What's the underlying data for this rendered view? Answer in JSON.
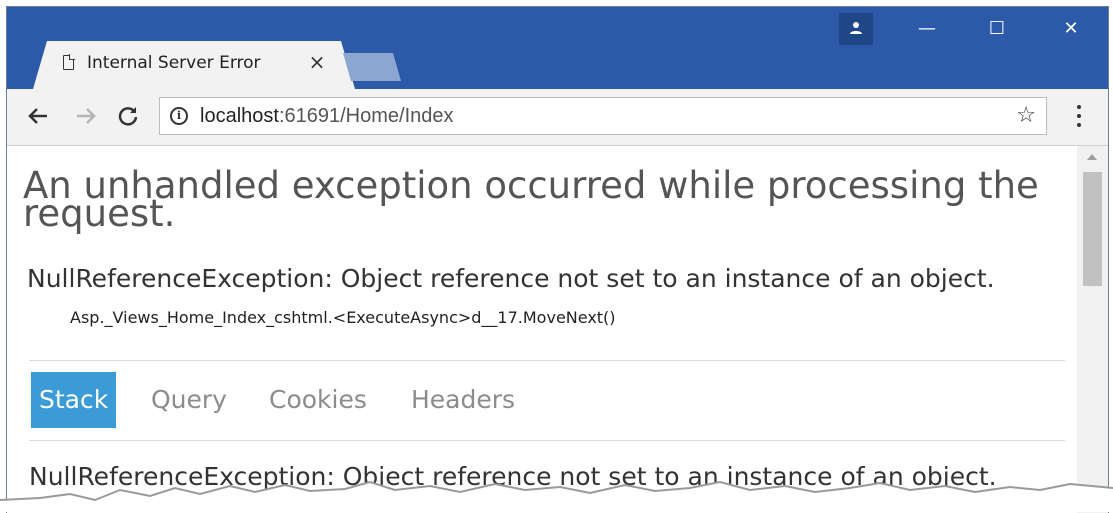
{
  "browser": {
    "tab_title": "Internal Server Error",
    "tab_close": "×",
    "url_host": "localhost",
    "url_rest": ":61691/Home/Index",
    "info_glyph": "i",
    "star_glyph": "☆",
    "window_controls": {
      "minimize": "—",
      "maximize": "☐",
      "close": "✕"
    },
    "colors": {
      "titlebar": "#2c5aa8",
      "tab_bg": "#f2f2f2",
      "new_tab": "#8aa6d1"
    }
  },
  "page": {
    "heading": "An unhandled exception occurred while processing the request.",
    "error_title": "NullReferenceException: Object reference not set to an instance of an object.",
    "error_location": "Asp._Views_Home_Index_cshtml.<ExecuteAsync>d__17.MoveNext()",
    "tabs": [
      {
        "label": "Stack",
        "active": true
      },
      {
        "label": "Query",
        "active": false
      },
      {
        "label": "Cookies",
        "active": false
      },
      {
        "label": "Headers",
        "active": false
      }
    ],
    "stack_title": "NullReferenceException: Object reference not set to an instance of an object.",
    "colors": {
      "active_tab": "#3a9bd6",
      "inactive_tab_text": "#8c8c8c"
    }
  }
}
